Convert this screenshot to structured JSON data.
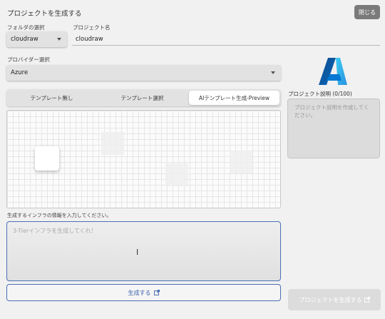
{
  "header": {
    "title": "プロジェクトを生成する",
    "close_label": "閉じる"
  },
  "folder": {
    "label": "フォルダの選択",
    "value": "cloudraw"
  },
  "project_name": {
    "label": "プロジェクト名",
    "value": "cloudraw"
  },
  "provider": {
    "label": "プロバイダー選択",
    "value": "Azure"
  },
  "tabs": [
    {
      "label": "テンプレート無し",
      "active": false
    },
    {
      "label": "テンプレート選択",
      "active": false
    },
    {
      "label": "AIテンプレート生成-Preview",
      "active": true
    }
  ],
  "prompt": {
    "label": "生成するインフラの情報を入力してください。",
    "placeholder": "3-Tierインフラを生成してくれ！"
  },
  "generate_button": {
    "label": "生成する",
    "icon": "external-link-icon"
  },
  "description": {
    "label": "プロジェクト説明 (0/100)",
    "placeholder": "プロジェクト説明を作成してください。"
  },
  "create_button": {
    "label": "プロジェクトを生成する",
    "icon": "external-link-icon"
  },
  "colors": {
    "accent": "#4a6fb5",
    "azure_blue": "#0078d4"
  }
}
